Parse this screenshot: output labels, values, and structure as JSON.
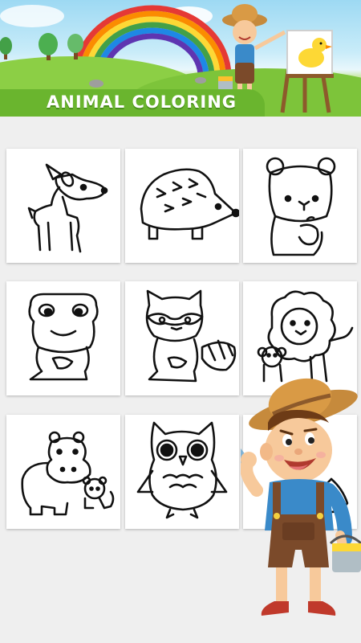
{
  "app": {
    "title": "ANIMAL COLORING"
  },
  "gallery": {
    "items": [
      {
        "animal": "fawn"
      },
      {
        "animal": "hedgehog"
      },
      {
        "animal": "bear"
      },
      {
        "animal": "frog"
      },
      {
        "animal": "raccoon"
      },
      {
        "animal": "lion"
      },
      {
        "animal": "hippo"
      },
      {
        "animal": "owl"
      },
      {
        "animal": "fox"
      }
    ]
  },
  "colors": {
    "banner_green": "#6ab52e",
    "background": "#efefef",
    "card": "#ffffff",
    "line_art": "#111111"
  }
}
